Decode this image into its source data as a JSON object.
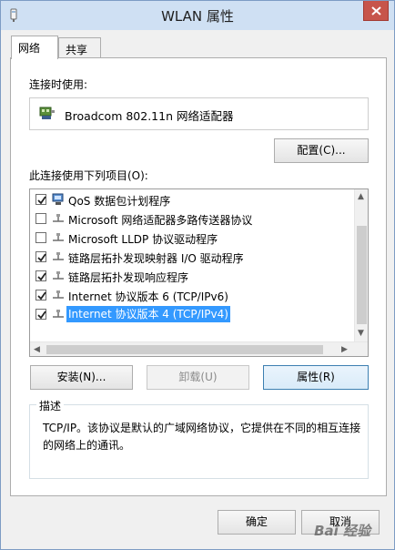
{
  "window": {
    "title": "WLAN 属性",
    "accent": "#cfe0f3",
    "close_color": "#c7554b"
  },
  "tabs": [
    {
      "label": "网络",
      "active": true
    },
    {
      "label": "共享",
      "active": false
    }
  ],
  "connect_using": {
    "label": "连接时使用:",
    "adapter": "Broadcom 802.11n 网络适配器",
    "configure_button": "配置(C)..."
  },
  "items_section": {
    "label": "此连接使用下列项目(O):",
    "items": [
      {
        "label": "QoS 数据包计划程序",
        "checked": true,
        "selected": false,
        "icon": "qos-scheduler-icon"
      },
      {
        "label": "Microsoft 网络适配器多路传送器协议",
        "checked": false,
        "selected": false,
        "icon": "protocol-icon"
      },
      {
        "label": "Microsoft LLDP 协议驱动程序",
        "checked": false,
        "selected": false,
        "icon": "protocol-icon"
      },
      {
        "label": "链路层拓扑发现映射器 I/O 驱动程序",
        "checked": true,
        "selected": false,
        "icon": "protocol-icon"
      },
      {
        "label": "链路层拓扑发现响应程序",
        "checked": true,
        "selected": false,
        "icon": "protocol-icon"
      },
      {
        "label": "Internet 协议版本 6 (TCP/IPv6)",
        "checked": true,
        "selected": false,
        "icon": "protocol-icon"
      },
      {
        "label": "Internet 协议版本 4 (TCP/IPv4)",
        "checked": true,
        "selected": true,
        "icon": "protocol-icon"
      }
    ],
    "selection_color": "#3399ff"
  },
  "buttons": {
    "install": "安装(N)...",
    "uninstall": "卸载(U)",
    "properties": "属性(R)",
    "ok": "确定",
    "cancel": "取消"
  },
  "description": {
    "title": "描述",
    "text": "TCP/IP。该协议是默认的广域网络协议，它提供在不同的相互连接的网络上的通讯。"
  },
  "watermark": "Bai 经验"
}
